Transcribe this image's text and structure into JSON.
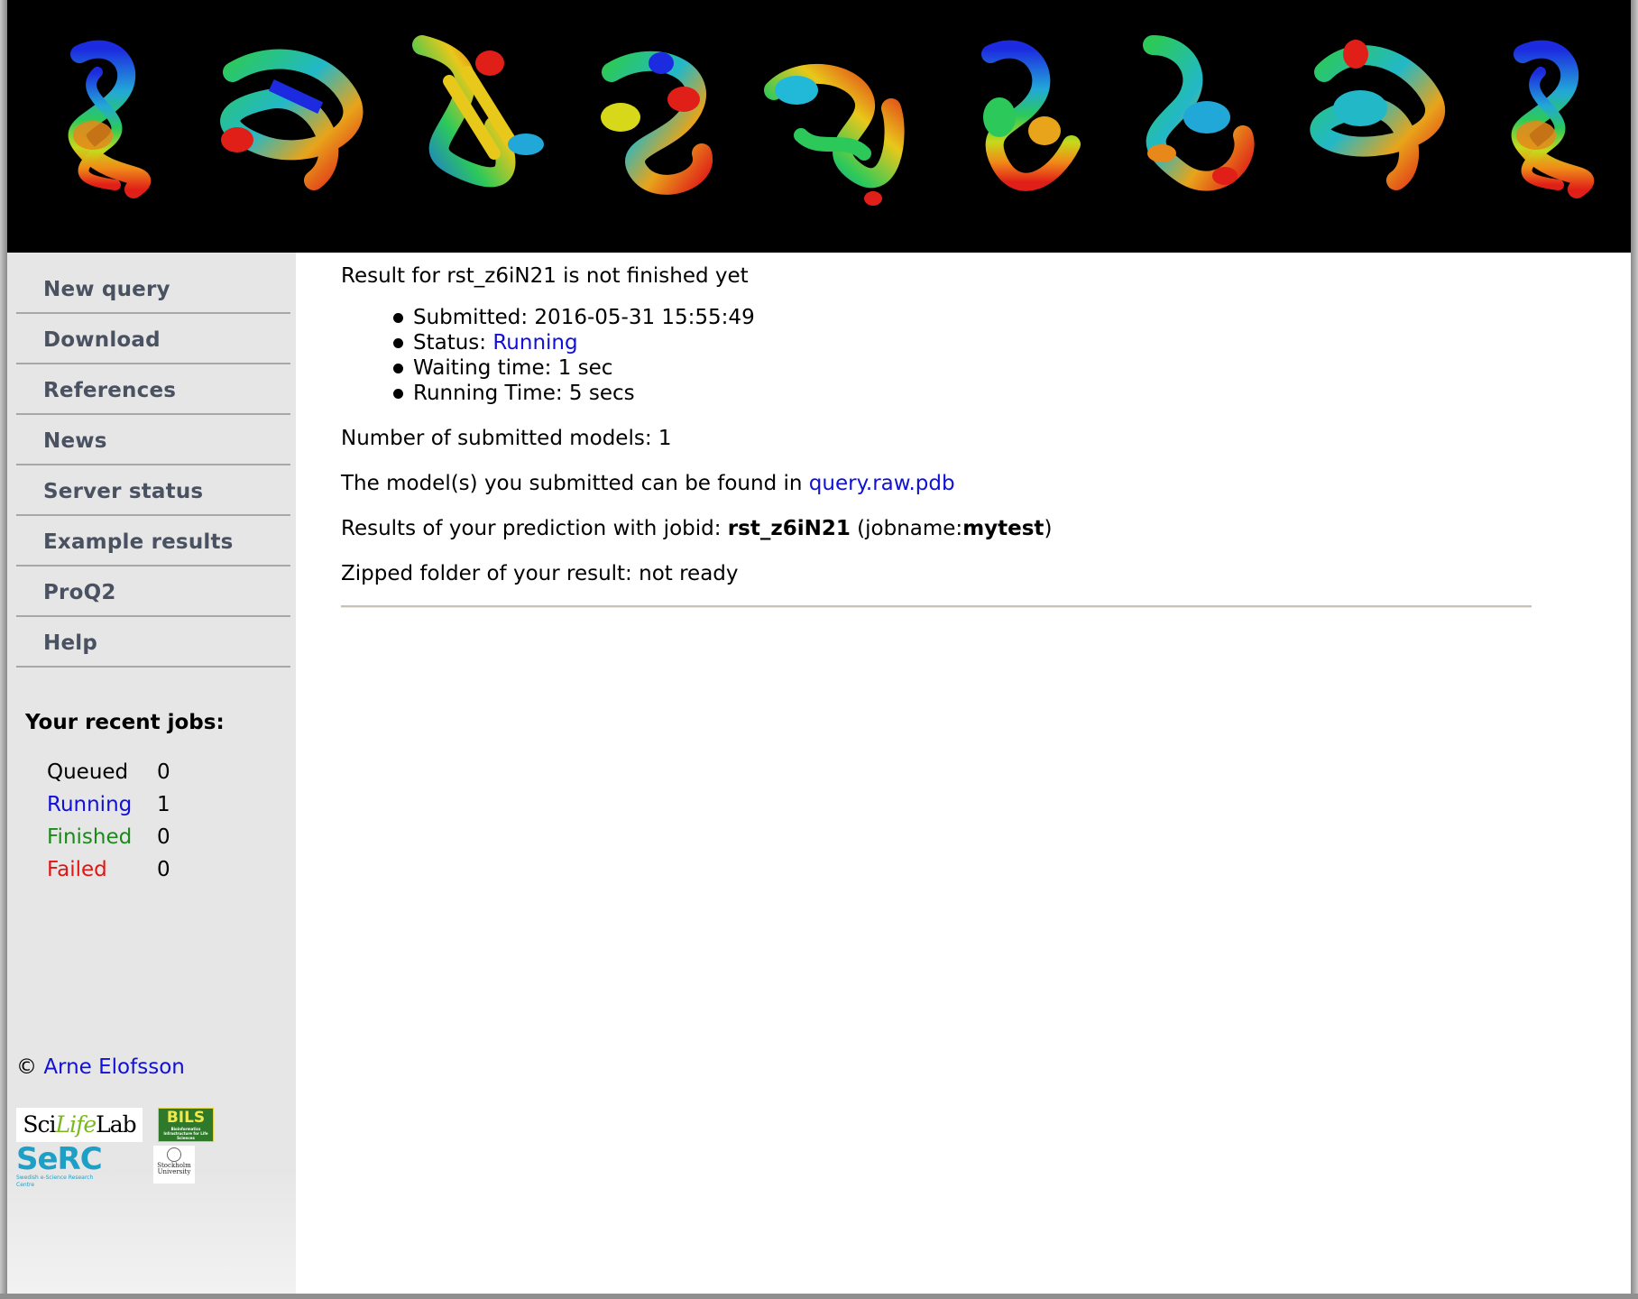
{
  "banner": {
    "structures": [
      {
        "name": "protein-structure-1"
      },
      {
        "name": "protein-structure-2"
      },
      {
        "name": "protein-structure-3"
      },
      {
        "name": "protein-structure-4"
      },
      {
        "name": "protein-structure-5"
      },
      {
        "name": "protein-structure-6"
      },
      {
        "name": "protein-structure-7"
      },
      {
        "name": "protein-structure-8"
      },
      {
        "name": "protein-structure-9"
      }
    ]
  },
  "sidebar": {
    "items": [
      {
        "label": "New query"
      },
      {
        "label": "Download"
      },
      {
        "label": "References"
      },
      {
        "label": "News"
      },
      {
        "label": "Server status"
      },
      {
        "label": "Example results"
      },
      {
        "label": "ProQ2"
      },
      {
        "label": "Help"
      }
    ],
    "recent_jobs": {
      "title": "Your recent jobs:",
      "rows": [
        {
          "label": "Queued",
          "count": "0",
          "color": "#000000"
        },
        {
          "label": "Running",
          "count": "1",
          "color": "#1010d8"
        },
        {
          "label": "Finished",
          "count": "0",
          "color": "#1a8a1a"
        },
        {
          "label": "Failed",
          "count": "0",
          "color": "#e01515"
        }
      ]
    },
    "copyright": {
      "symbol": "©",
      "author": "Arne Elofsson"
    },
    "logos": {
      "scilifelab": {
        "pre": "Sci",
        "mid": "Life",
        "post": "Lab"
      },
      "bils": {
        "text": "BILS",
        "tagline": "Bioinformatics Infrastructure for Life Sciences"
      },
      "serc": {
        "text": "SeRC",
        "tagline": "Swedish e-Science Research Centre"
      },
      "stockholm": {
        "line1": "Stockholm",
        "line2": "University"
      }
    }
  },
  "main": {
    "heading": "Result for rst_z6iN21 is not finished yet",
    "status": {
      "submitted_label": "Submitted:",
      "submitted_value": "2016-05-31 15:55:49",
      "status_label": "Status:",
      "status_value": "Running",
      "waiting_label": "Waiting time:",
      "waiting_value": "1 sec",
      "running_label": "Running Time:",
      "running_value": "5 secs"
    },
    "models_label": "Number of submitted models:",
    "models_count": "1",
    "model_file_text": "The model(s) you submitted can be found in",
    "model_file_link": "query.raw.pdb",
    "jobid_text": "Results of your prediction with jobid:",
    "jobid": "rst_z6iN21",
    "jobname_prefix": "(jobname:",
    "jobname": "mytest",
    "jobname_suffix": ")",
    "zipped_label": "Zipped folder of your result:",
    "zipped_value": "not ready"
  },
  "colors": {
    "link": "#1010d8",
    "nav_text": "#4a5262",
    "sidebar_bg": "#e6e6e6",
    "banner_bg": "#000000"
  }
}
